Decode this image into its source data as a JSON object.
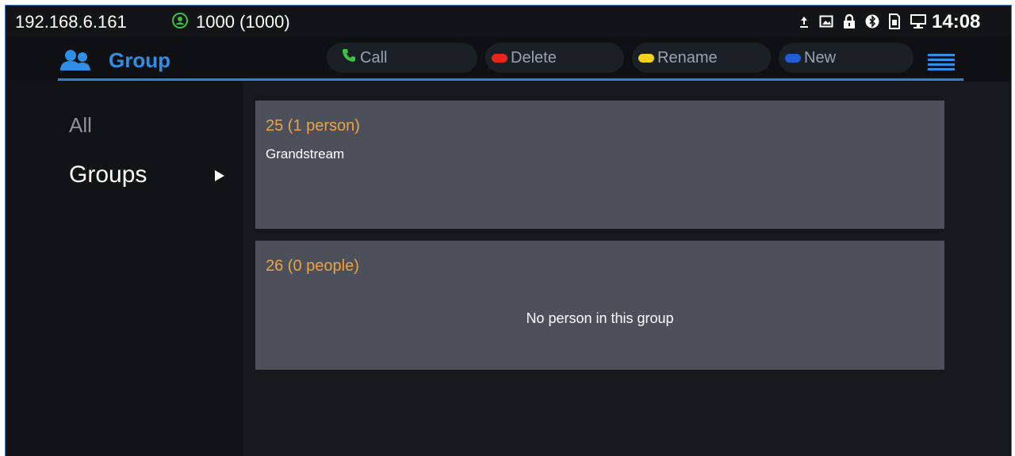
{
  "status_bar": {
    "ip_address": "192.168.6.161",
    "account": "1000 (1000)",
    "account_color": "#39c240",
    "time": "14:08",
    "icons": [
      "upload-icon",
      "image-icon",
      "lock-icon",
      "bluetooth-icon",
      "sim-icon",
      "network-icon"
    ]
  },
  "header": {
    "title": "Group",
    "title_color": "#2f8fe6",
    "softkeys": {
      "call": {
        "label": "Call",
        "color": "#38c43c"
      },
      "delete": {
        "label": "Delete",
        "color": "#e8241c"
      },
      "rename": {
        "label": "Rename",
        "color": "#f2d21a"
      },
      "new": {
        "label": "New",
        "color": "#1f5fd6"
      }
    }
  },
  "sidebar": {
    "items": [
      {
        "label": "All",
        "selected": false
      },
      {
        "label": "Groups",
        "selected": true
      }
    ]
  },
  "groups": [
    {
      "title": "25 (1 person)",
      "members": [
        "Grandstream"
      ]
    },
    {
      "title": "26 (0 people)",
      "empty_message": "No person in this group"
    }
  ]
}
